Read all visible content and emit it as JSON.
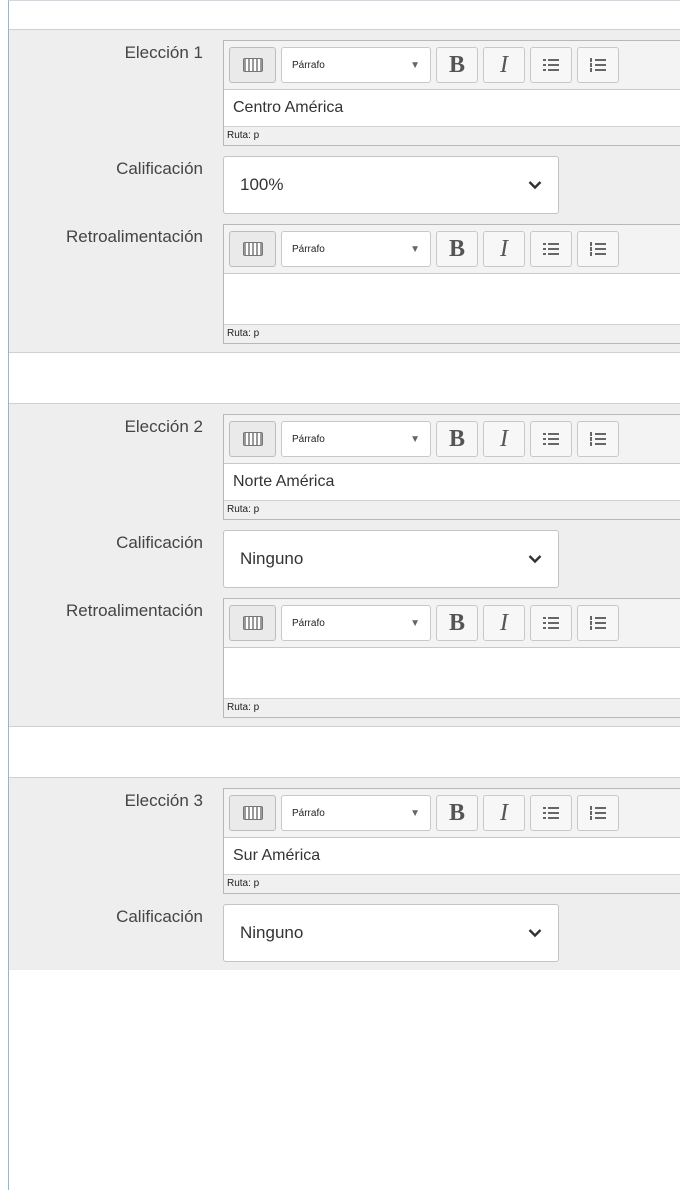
{
  "choices": [
    {
      "label": "Elección 1",
      "answer": "Centro América",
      "path_text": "Ruta: p",
      "grade_label": "Calificación",
      "grade_value": "100%",
      "feedback_label": "Retroalimentación",
      "feedback_text": "",
      "feedback_path": "Ruta: p"
    },
    {
      "label": "Elección 2",
      "answer": "Norte América",
      "path_text": "Ruta: p",
      "grade_label": "Calificación",
      "grade_value": "Ninguno",
      "feedback_label": "Retroalimentación",
      "feedback_text": "",
      "feedback_path": "Ruta: p"
    },
    {
      "label": "Elección 3",
      "answer": "Sur América",
      "path_text": "Ruta: p",
      "grade_label": "Calificación",
      "grade_value": "Ninguno"
    }
  ],
  "toolbar": {
    "format_label": "Párrafo",
    "bold_label": "B",
    "italic_label": "I"
  }
}
